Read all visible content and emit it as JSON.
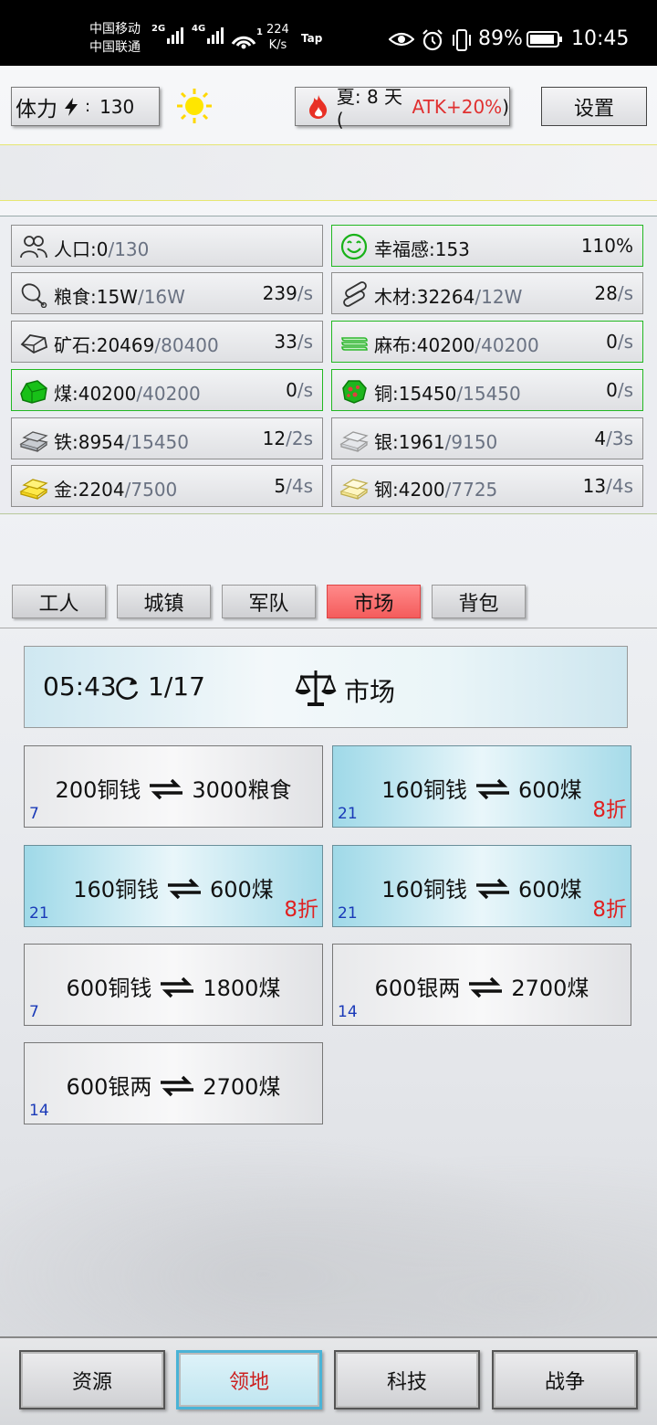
{
  "status_bar": {
    "carrier1": "中国移动",
    "carrier2": "中国联通",
    "sig1": "2G",
    "sig2": "4G",
    "wifi_badge": "1",
    "speed_value": "224",
    "speed_unit": "K/s",
    "tap": "Tap",
    "battery": "89%",
    "time": "10:45",
    "icons": [
      "eye-icon",
      "alarm-icon",
      "vibrate-icon",
      "battery-icon"
    ]
  },
  "top": {
    "stamina_label": "体力",
    "stamina_sep": ":",
    "stamina_value": "130",
    "season_text": "夏: 8 天 (",
    "season_atk": "ATK+20%",
    "season_close": ")",
    "settings": "设置"
  },
  "resources": [
    {
      "name": "人口:0",
      "max": "/130",
      "rate": "",
      "unit": "",
      "icon": "people-icon"
    },
    {
      "name": "幸福感:153",
      "max": "",
      "rate": "110%",
      "unit": "",
      "icon": "smile-icon"
    },
    {
      "name": "粮食:15W",
      "max": "/16W",
      "rate": "239",
      "unit": "/s",
      "icon": "food-icon"
    },
    {
      "name": "木材:32264",
      "max": "/12W",
      "rate": "28",
      "unit": "/s",
      "icon": "wood-icon"
    },
    {
      "name": "矿石:20469",
      "max": "/80400",
      "rate": "33",
      "unit": "/s",
      "icon": "ore-icon"
    },
    {
      "name": "麻布:40200",
      "max": "/40200",
      "rate": "0",
      "unit": "/s",
      "icon": "linen-icon"
    },
    {
      "name": "煤:40200",
      "max": "/40200",
      "rate": "0",
      "unit": "/s",
      "icon": "coal-icon"
    },
    {
      "name": "铜:15450",
      "max": "/15450",
      "rate": "0",
      "unit": "/s",
      "icon": "copper-icon"
    },
    {
      "name": "铁:8954",
      "max": "/15450",
      "rate": "12",
      "unit": "/2s",
      "icon": "iron-icon"
    },
    {
      "name": "银:1961",
      "max": "/9150",
      "rate": "4",
      "unit": "/3s",
      "icon": "silver-icon"
    },
    {
      "name": "金:2204",
      "max": "/7500",
      "rate": "5",
      "unit": "/4s",
      "icon": "gold-icon"
    },
    {
      "name": "钢:4200",
      "max": "/7725",
      "rate": "13",
      "unit": "/4s",
      "icon": "steel-icon"
    }
  ],
  "tabs": [
    "工人",
    "城镇",
    "军队",
    "市场",
    "背包"
  ],
  "active_tab": "市场",
  "market": {
    "timer": "05:43",
    "count": "1/17",
    "title": "市场"
  },
  "offers": [
    {
      "give": "200铜钱",
      "get": "3000粮食",
      "qty": "7",
      "discount": ""
    },
    {
      "give": "160铜钱",
      "get": "600煤",
      "qty": "21",
      "discount": "8折"
    },
    {
      "give": "160铜钱",
      "get": "600煤",
      "qty": "21",
      "discount": "8折"
    },
    {
      "give": "160铜钱",
      "get": "600煤",
      "qty": "21",
      "discount": "8折"
    },
    {
      "give": "600铜钱",
      "get": "1800煤",
      "qty": "7",
      "discount": ""
    },
    {
      "give": "600银两",
      "get": "2700煤",
      "qty": "14",
      "discount": ""
    },
    {
      "give": "600银两",
      "get": "2700煤",
      "qty": "14",
      "discount": ""
    }
  ],
  "bottom_nav": [
    "资源",
    "领地",
    "科技",
    "战争"
  ],
  "active_nav": "领地"
}
